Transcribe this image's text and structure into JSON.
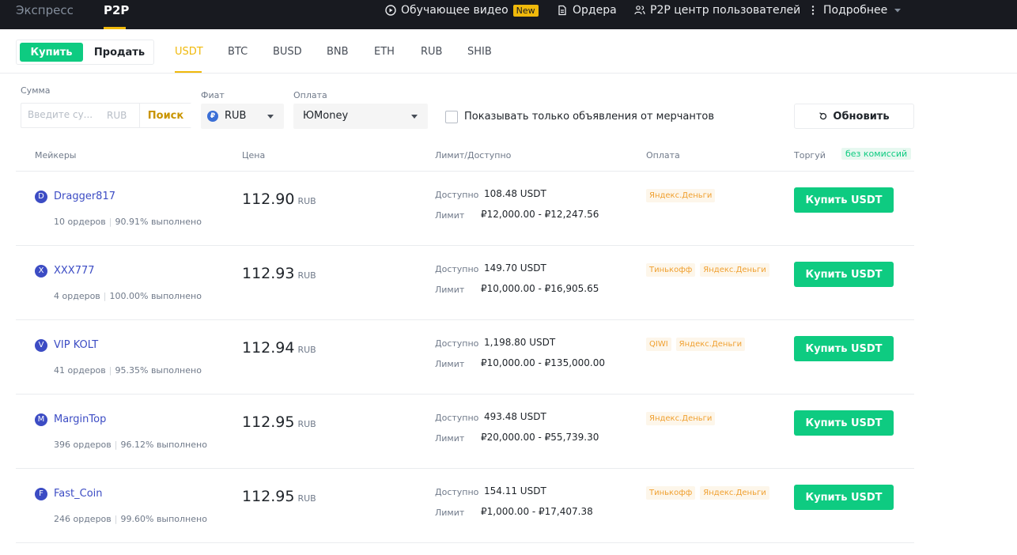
{
  "topbar": {
    "tab_express": "Экспресс",
    "tab_p2p": "P2P",
    "video_label": "Обучающее видео",
    "new_badge": "New",
    "orders_label": "Ордера",
    "user_center_label": "P2P центр пользователей",
    "more_label": "Подробнее"
  },
  "trade_toggle": {
    "buy": "Купить",
    "sell": "Продать"
  },
  "assets": [
    "USDT",
    "BTC",
    "BUSD",
    "BNB",
    "ETH",
    "RUB",
    "SHIB"
  ],
  "filters": {
    "amount_label": "Сумма",
    "amount_placeholder": "Введите су...",
    "amount_unit": "RUB",
    "search_label": "Поиск",
    "fiat_label": "Фиат",
    "fiat_symbol": "₽",
    "fiat_value": "RUB",
    "payment_label": "Оплата",
    "payment_value": "ЮMoney",
    "merchant_only_label": "Показывать только объявления от мерчантов",
    "refresh_label": "Обновить"
  },
  "table": {
    "col_makers": "Мейкеры",
    "col_price": "Цена",
    "col_limit": "Лимит/Доступно",
    "col_payment": "Оплата",
    "col_trade": "Торгуй",
    "fee_badge": "без комиссий",
    "available_label": "Доступно",
    "limit_label": "Лимит",
    "price_unit": "RUB",
    "buy_label": "Купить USDT"
  },
  "rows": [
    {
      "initial": "D",
      "name": "Dragger817",
      "orders": "10 ордеров",
      "completion": "90.91% выполнено",
      "price": "112.90",
      "available": "108.48 USDT",
      "limit": "₽12,000.00 - ₽12,247.56",
      "payments": [
        "Яндекс.Деньги"
      ]
    },
    {
      "initial": "X",
      "name": "XXX777",
      "orders": "4 ордеров",
      "completion": "100.00% выполнено",
      "price": "112.93",
      "available": "149.70 USDT",
      "limit": "₽10,000.00 - ₽16,905.65",
      "payments": [
        "Тинькофф",
        "Яндекс.Деньги"
      ]
    },
    {
      "initial": "V",
      "name": "VIP KOLT",
      "orders": "41 ордеров",
      "completion": "95.35% выполнено",
      "price": "112.94",
      "available": "1,198.80 USDT",
      "limit": "₽10,000.00 - ₽135,000.00",
      "payments": [
        "QIWI",
        "Яндекс.Деньги"
      ]
    },
    {
      "initial": "M",
      "name": "MarginTop",
      "orders": "396 ордеров",
      "completion": "96.12% выполнено",
      "price": "112.95",
      "available": "493.48 USDT",
      "limit": "₽20,000.00 - ₽55,739.30",
      "payments": [
        "Яндекс.Деньги"
      ]
    },
    {
      "initial": "F",
      "name": "Fast_Coin",
      "orders": "246 ордеров",
      "completion": "99.60% выполнено",
      "price": "112.95",
      "available": "154.11 USDT",
      "limit": "₽1,000.00 - ₽17,407.38",
      "payments": [
        "Тинькофф",
        "Яндекс.Деньги"
      ]
    }
  ],
  "colors": {
    "accent": "#f0b90b",
    "buy": "#0ecb81",
    "maker": "#3c4cc4",
    "topbar": "#181a20"
  }
}
